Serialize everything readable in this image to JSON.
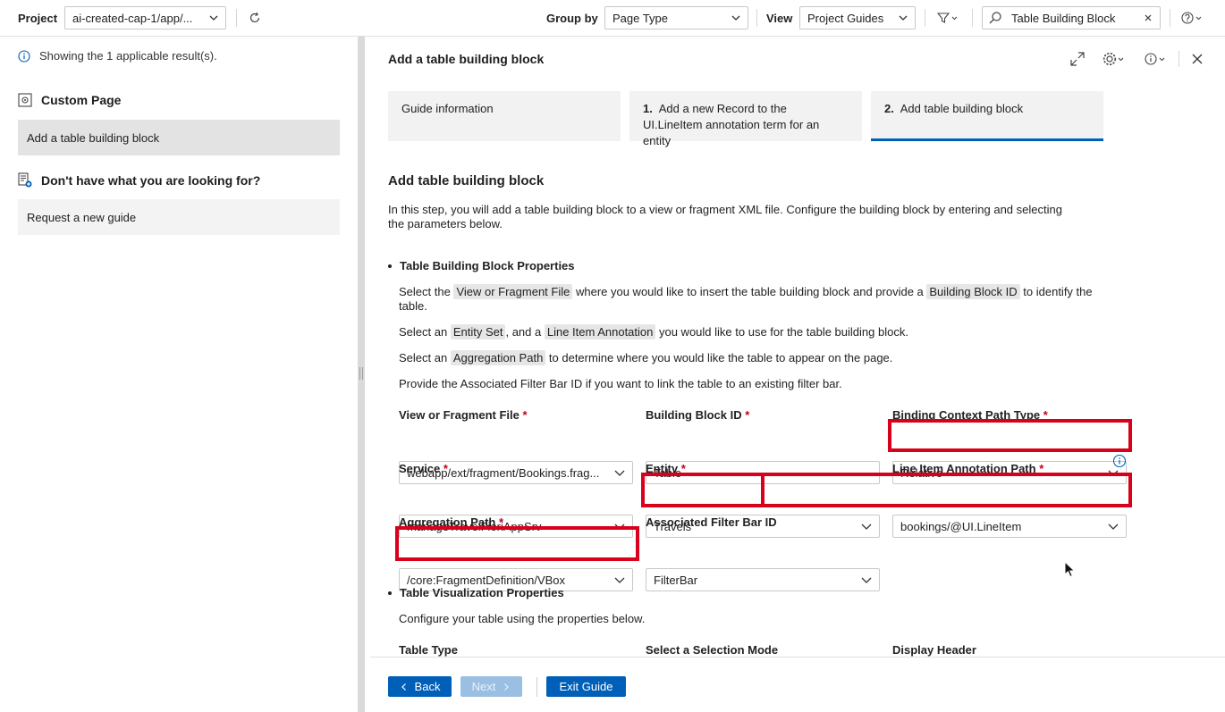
{
  "toolbar": {
    "project_label": "Project",
    "project_value": "ai-created-cap-1/app/...",
    "group_by_label": "Group by",
    "group_by_value": "Page Type",
    "view_label": "View",
    "view_value": "Project Guides",
    "search_value": "Table Building Block"
  },
  "sidebar": {
    "info_text": "Showing the 1 applicable result(s).",
    "section1_title": "Custom Page",
    "section1_item": "Add a table building block",
    "section2_title": "Don't have what you are looking for?",
    "section2_item": "Request a new guide"
  },
  "main": {
    "title": "Add a table building block",
    "steps": [
      {
        "number": "",
        "label": "Guide information"
      },
      {
        "number": "1.",
        "label": "Add a new Record to the UI.LineItem annotation term for an entity"
      },
      {
        "number": "2.",
        "label": "Add table building block"
      }
    ],
    "heading": "Add table building block",
    "intro": "In this step, you will add a table building block to a view or fragment XML file. Configure the building block by entering and selecting the parameters below.",
    "section_properties": "Table Building Block Properties",
    "p1_a": "Select the ",
    "p1_tag1": "View or Fragment File",
    "p1_b": " where you would like to insert the table building block and provide a ",
    "p1_tag2": "Building Block ID",
    "p1_c": " to identify the table.",
    "p2_a": "Select an ",
    "p2_tag1": "Entity Set",
    "p2_b": ", and a ",
    "p2_tag2": "Line Item Annotation",
    "p2_c": " you would like to use for the table building block.",
    "p3_a": "Select an ",
    "p3_tag1": "Aggregation Path",
    "p3_b": " to determine where you would like the table to appear on the page.",
    "p4": "Provide the Associated Filter Bar ID if you want to link the table to an existing filter bar.",
    "fields": {
      "view_file_label": "View or Fragment File",
      "view_file_value": "webapp/ext/fragment/Bookings.frag...",
      "block_id_label": "Building Block ID",
      "block_id_value": "Table",
      "binding_label": "Binding Context Path Type",
      "binding_value": "Relative",
      "service_label": "Service",
      "service_value": "manageTravelFioriAppSrv",
      "entity_label": "Entity",
      "entity_value": "Travels",
      "lineitem_label": "Line Item Annotation Path",
      "lineitem_value": "bookings/@UI.LineItem",
      "aggregation_label": "Aggregation Path",
      "aggregation_value": "/core:FragmentDefinition/VBox",
      "filterbar_label": "Associated Filter Bar ID",
      "filterbar_value": "FilterBar",
      "required_mark": "*"
    },
    "section_visualization": "Table Visualization Properties",
    "vis_intro": "Configure your table using the properties below.",
    "vis_col1": "Table Type",
    "vis_col2": "Select a Selection Mode",
    "vis_col3": "Display Header"
  },
  "footer": {
    "back": "Back",
    "next": "Next",
    "exit": "Exit Guide"
  },
  "colors": {
    "accent": "#005fb8",
    "highlight": "#d9001b",
    "required": "#c4001a"
  }
}
